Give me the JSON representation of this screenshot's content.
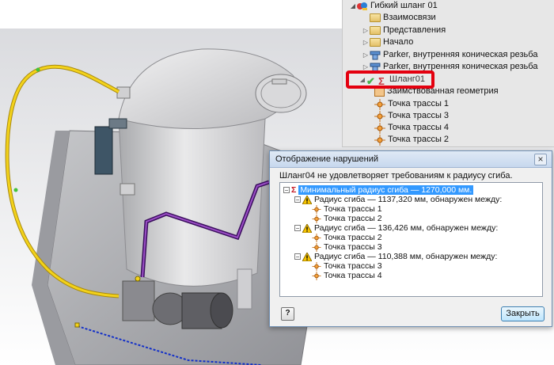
{
  "browser": {
    "root_label": "Гибкий шланг 01",
    "items": [
      {
        "label": "Взаимосвязи"
      },
      {
        "label": "Представления"
      },
      {
        "label": "Начало"
      },
      {
        "label": "Parker, внутренняя коническая резьба"
      },
      {
        "label": "Parker, внутренняя коническая резьба"
      },
      {
        "label": "Шланг01"
      },
      {
        "label": "Заимствованная геометрия"
      },
      {
        "label": "Точка трассы 1"
      },
      {
        "label": "Точка трассы 3"
      },
      {
        "label": "Точка трассы 4"
      },
      {
        "label": "Точка трассы 2"
      }
    ]
  },
  "dialog": {
    "title": "Отображение нарушений",
    "message": "Шланг04 не удовлетворяет требованиям к радиусу сгиба.",
    "root": "Минимальный радиус сгиба — 1270,000 мм.",
    "violations": [
      {
        "label": "Радиус сгиба — 1137,320 мм, обнаружен между:",
        "points": [
          "Точка трассы 1",
          "Точка трассы 2"
        ]
      },
      {
        "label": "Радиус сгиба — 136,426 мм, обнаружен между:",
        "points": [
          "Точка трассы 2",
          "Точка трассы 3"
        ]
      },
      {
        "label": "Радиус сгиба — 110,388 мм, обнаружен между:",
        "points": [
          "Точка трассы 3",
          "Точка трассы 4"
        ]
      }
    ],
    "close_button": "Закрыть",
    "close_icon": "×",
    "help_icon": "?"
  },
  "colors": {
    "highlight": "#e4000f",
    "hose_yellow": "#f3d21a",
    "hose_purple": "#5b1d86",
    "selection": "#3399ff"
  }
}
